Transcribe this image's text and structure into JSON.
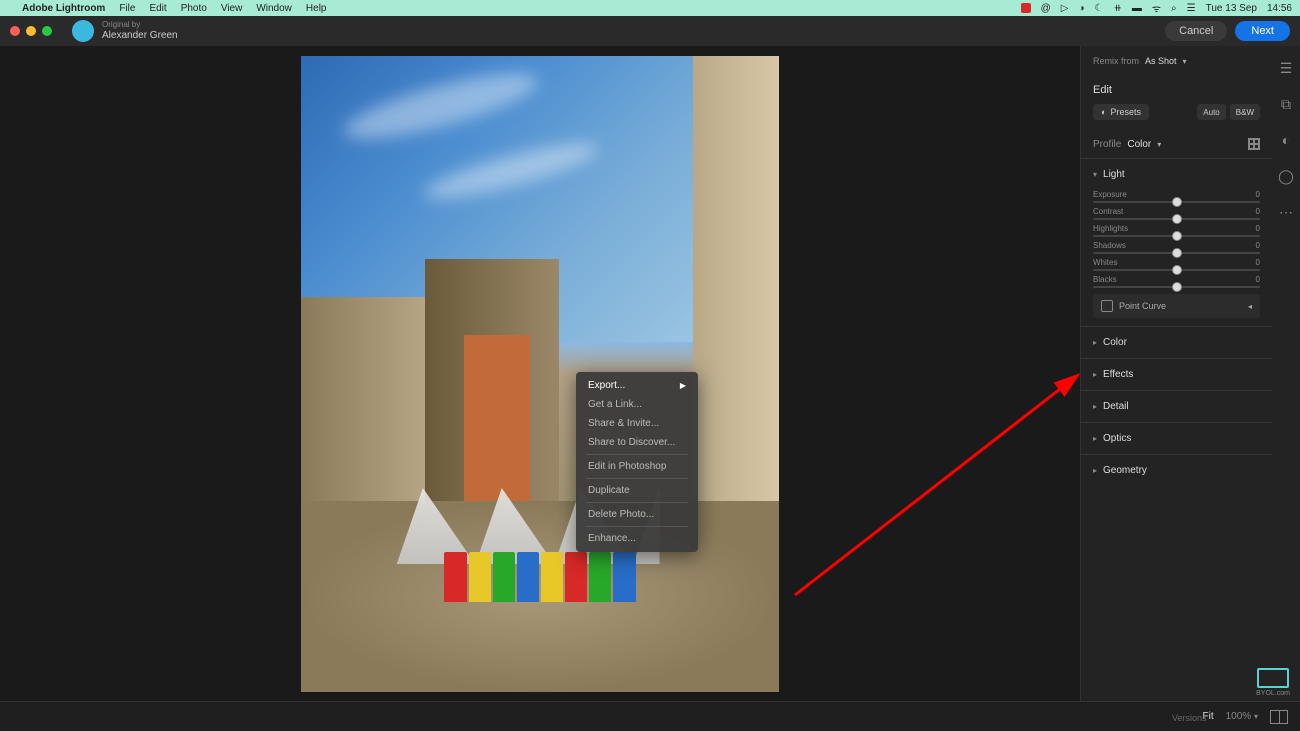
{
  "menubar": {
    "app_name": "Adobe Lightroom",
    "items": [
      "File",
      "Edit",
      "Photo",
      "View",
      "Window",
      "Help"
    ],
    "date": "Tue 13 Sep",
    "time": "14:56"
  },
  "header": {
    "original_by": "Original by",
    "user_name": "Alexander Green",
    "cancel": "Cancel",
    "next": "Next"
  },
  "context_menu": {
    "items": [
      {
        "label": "Export...",
        "has_sub": true,
        "highlight": true
      },
      {
        "label": "Get a Link...",
        "highlight": false
      },
      {
        "label": "Share & Invite...",
        "highlight": false
      },
      {
        "label": "Share to Discover...",
        "highlight": false
      },
      {
        "sep": true
      },
      {
        "label": "Edit in Photoshop",
        "highlight": false
      },
      {
        "sep": true
      },
      {
        "label": "Duplicate",
        "highlight": false
      },
      {
        "sep": true
      },
      {
        "label": "Delete Photo...",
        "highlight": false
      },
      {
        "sep": true
      },
      {
        "label": "Enhance...",
        "highlight": false
      }
    ]
  },
  "panel": {
    "remix_label": "Remix from",
    "remix_value": "As Shot",
    "edit_title": "Edit",
    "presets": "Presets",
    "auto": "Auto",
    "bw": "B&W",
    "profile_label": "Profile",
    "profile_value": "Color",
    "light": {
      "title": "Light",
      "sliders": [
        {
          "name": "Exposure",
          "value": "0"
        },
        {
          "name": "Contrast",
          "value": "0"
        },
        {
          "name": "Highlights",
          "value": "0"
        },
        {
          "name": "Shadows",
          "value": "0"
        },
        {
          "name": "Whites",
          "value": "0"
        },
        {
          "name": "Blacks",
          "value": "0"
        }
      ],
      "point_curve": "Point Curve"
    },
    "sections": [
      "Color",
      "Effects",
      "Detail",
      "Optics",
      "Geometry"
    ]
  },
  "bottom": {
    "fit": "Fit",
    "zoom": "100%",
    "versions": "Versions"
  },
  "byol": "BYOL.com"
}
